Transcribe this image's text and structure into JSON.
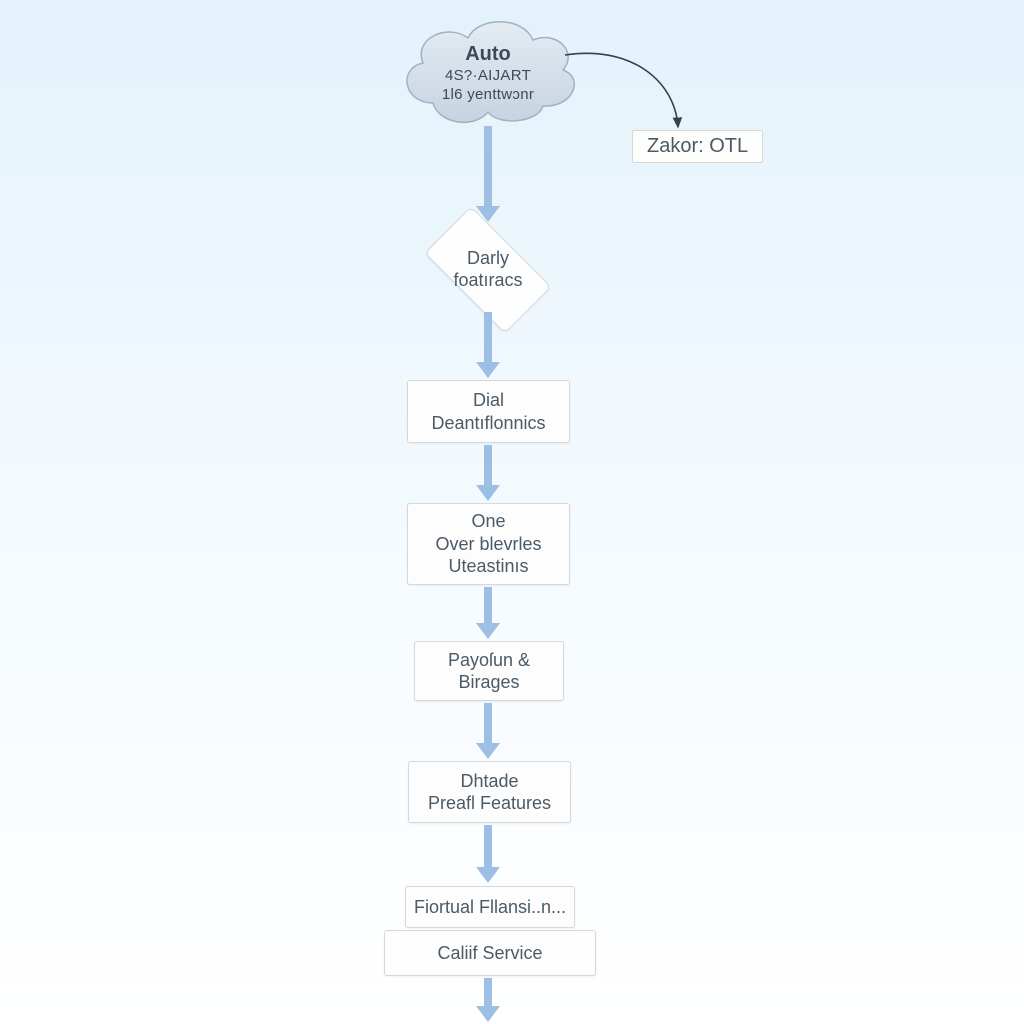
{
  "cloud": {
    "title": "Auto",
    "line2": "4S?·AIJART",
    "line3": "1l6 yenttwɔnr"
  },
  "sidenote": "Zakor: OTL",
  "decision": {
    "line1": "Darly",
    "line2": "foatıracs"
  },
  "steps": {
    "step1": {
      "line1": "Dial",
      "line2": "Deantıflonnics"
    },
    "step2": {
      "line1": "One",
      "line2": "Over blevrles",
      "line3": "Uteastinıs"
    },
    "step3": {
      "line1": "Payoſun &",
      "line2": "Birages"
    },
    "step4": {
      "line1": "Dhtade",
      "line2": "Preafl Features"
    },
    "step5": {
      "line1": "Fiortual Fllansi..n..."
    },
    "step6": {
      "line1": "Caliif Service"
    }
  }
}
